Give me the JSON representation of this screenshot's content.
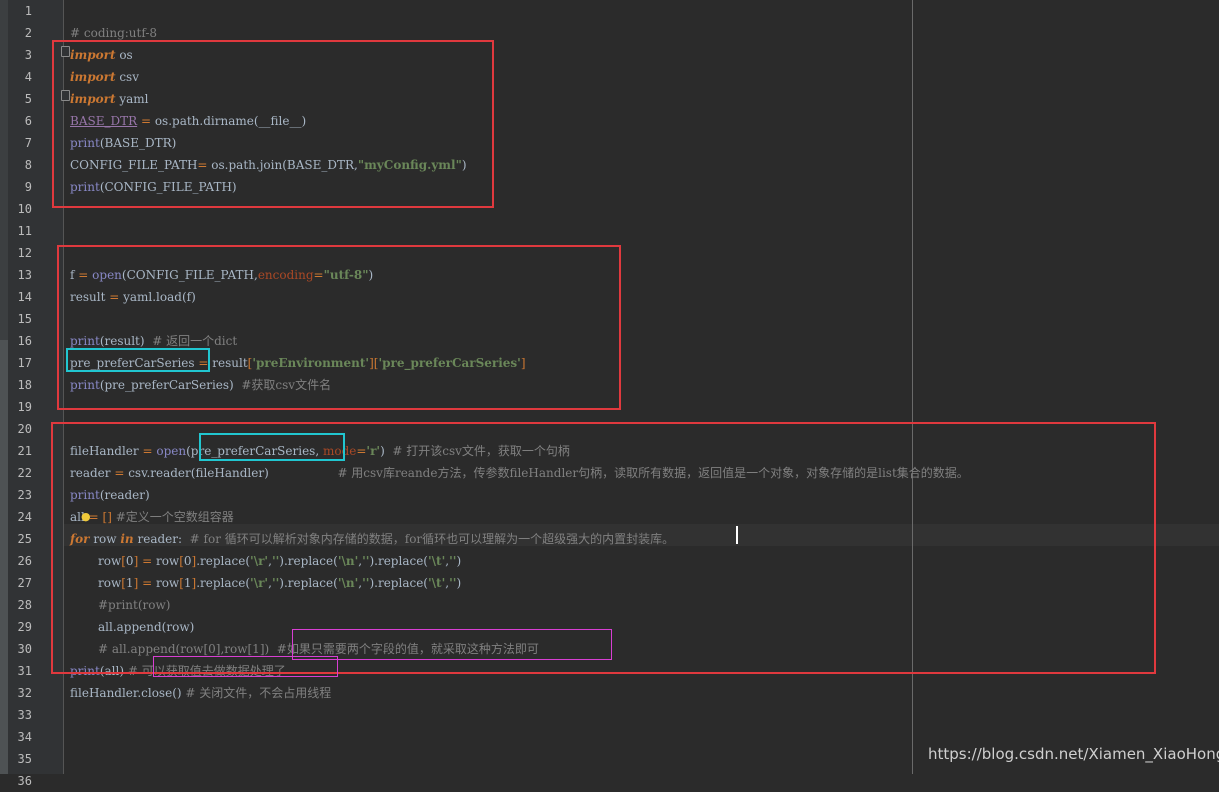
{
  "editor": {
    "lines": [
      {
        "n": "1",
        "code": ""
      },
      {
        "n": "2",
        "code": "# coding:utf-8"
      },
      {
        "n": "3",
        "code": "import os"
      },
      {
        "n": "4",
        "code": "import csv"
      },
      {
        "n": "5",
        "code": "import yaml"
      },
      {
        "n": "6",
        "code": "BASE_DTR = os.path.dirname(__file__)"
      },
      {
        "n": "7",
        "code": "print(BASE_DTR)"
      },
      {
        "n": "8",
        "code": "CONFIG_FILE_PATH= os.path.join(BASE_DTR,\"myConfig.yml\")"
      },
      {
        "n": "9",
        "code": "print(CONFIG_FILE_PATH)"
      },
      {
        "n": "10",
        "code": ""
      },
      {
        "n": "11",
        "code": ""
      },
      {
        "n": "12",
        "code": ""
      },
      {
        "n": "13",
        "code": "f = open(CONFIG_FILE_PATH,encoding=\"utf-8\")"
      },
      {
        "n": "14",
        "code": "result = yaml.load(f)"
      },
      {
        "n": "15",
        "code": ""
      },
      {
        "n": "16",
        "code": "print(result)  # 返回一个dict"
      },
      {
        "n": "17",
        "code": "pre_preferCarSeries = result['preEnvironment']['pre_preferCarSeries']"
      },
      {
        "n": "18",
        "code": "print(pre_preferCarSeries)  #获取csv文件名"
      },
      {
        "n": "19",
        "code": ""
      },
      {
        "n": "20",
        "code": ""
      },
      {
        "n": "21",
        "code": "fileHandler = open(pre_preferCarSeries, mode='r')  # 打开该csv文件，获取一个句柄"
      },
      {
        "n": "22",
        "code": "reader = csv.reader(fileHandler)                  # 用csv库reande方法，传参数fileHandler句柄，读取所有数据，返回值是一个对象，对象存储的是list集合的数据。"
      },
      {
        "n": "23",
        "code": "print(reader)"
      },
      {
        "n": "24",
        "code": "all = [] #定义一个空数组容器"
      },
      {
        "n": "25",
        "code": "for row in reader:  # for 循环可以解析对象内存储的数据，for循环也可以理解为一个超级强大的内置封装库。"
      },
      {
        "n": "26",
        "code": "row[0] = row[0].replace('\\r','').replace('\\n','').replace('\\t','')"
      },
      {
        "n": "27",
        "code": "row[1] = row[1].replace('\\r','').replace('\\n','').replace('\\t','')"
      },
      {
        "n": "28",
        "code": "#print(row)"
      },
      {
        "n": "29",
        "code": "all.append(row)"
      },
      {
        "n": "30",
        "code": "# all.append(row[0],row[1])  #如果只需要两个字段的值，就采取这种方法即可"
      },
      {
        "n": "31",
        "code": "print(all) # 可以获取值去做数据处理了"
      },
      {
        "n": "32",
        "code": "fileHandler.close() # 关闭文件，不会占用线程"
      },
      {
        "n": "33",
        "code": ""
      },
      {
        "n": "34",
        "code": ""
      },
      {
        "n": "35",
        "code": ""
      },
      {
        "n": "36",
        "code": ""
      }
    ],
    "caret_line": "25"
  },
  "watermark": "https://blog.csdn.net/Xiamen_XiaoHong",
  "colors": {
    "background": "#2b2b2b",
    "gutter": "#313335",
    "keyword": "#cc7832",
    "string": "#6a8759",
    "comment": "#808080",
    "builtin": "#8888c6",
    "param": "#aa4926",
    "highlight_red": "#e0393e",
    "highlight_cyan": "#21c6d0",
    "highlight_magenta": "#d83fd3"
  }
}
